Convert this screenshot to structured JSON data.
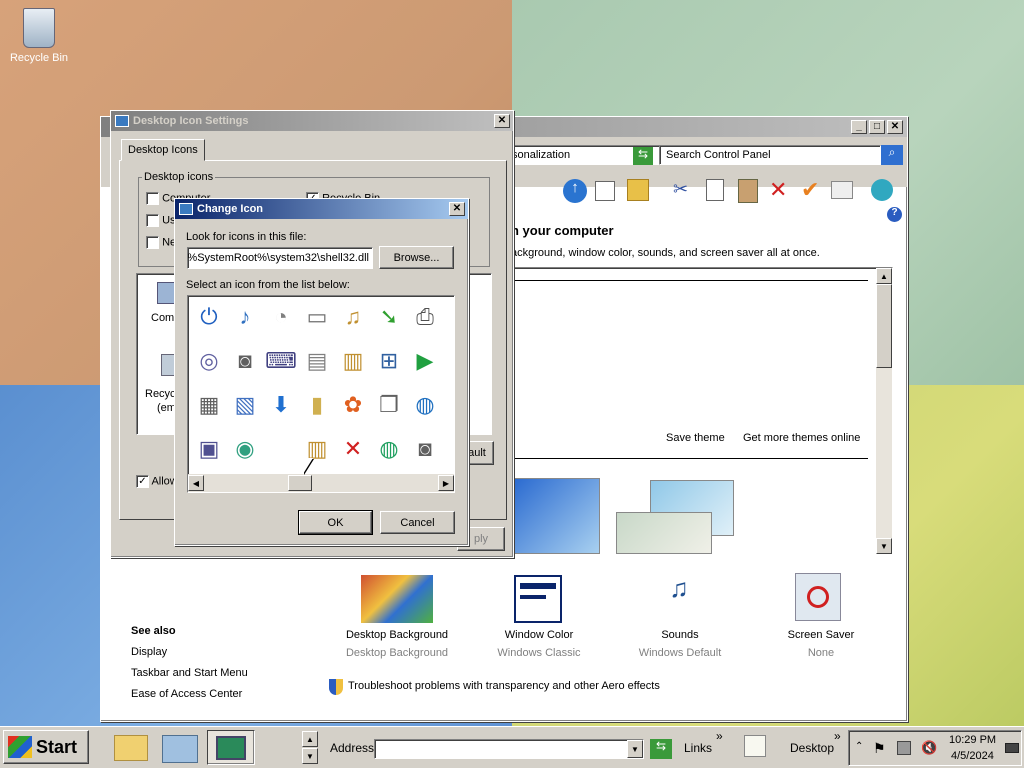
{
  "desktop": {
    "recycle_bin_label": "Recycle Bin"
  },
  "cp": {
    "address_text": "sonalization",
    "search_placeholder": "Search Control Panel",
    "heading": "n your computer",
    "subheading": "ackground, window color, sounds, and screen saver all at once.",
    "save_theme": "Save theme",
    "get_more_themes": "Get more themes online",
    "see_also_title": "See also",
    "see_also": [
      "Display",
      "Taskbar and Start Menu",
      "Ease of Access Center"
    ],
    "items": [
      {
        "label": "Desktop Background",
        "sub": "Desktop Background"
      },
      {
        "label": "Window Color",
        "sub": "Windows Classic"
      },
      {
        "label": "Sounds",
        "sub": "Windows Default"
      },
      {
        "label": "Screen Saver",
        "sub": "None"
      }
    ],
    "troubleshoot": "Troubleshoot problems with transparency and other Aero effects"
  },
  "dis": {
    "title": "Desktop Icon Settings",
    "tab": "Desktop Icons",
    "group": "Desktop icons",
    "cb_computer": "Computer",
    "cb_user": "Us",
    "cb_network": "Ne",
    "cb_recycle": "Recycle Bin",
    "list_computer": "Comp",
    "list_recycle": "Recyc",
    "list_recycle2": "(em",
    "allow": "Allow",
    "default_btn": "ault",
    "apply_btn": "ply"
  },
  "ci": {
    "title": "Change Icon",
    "look_label": "Look for icons in this file:",
    "file_path": "%SystemRoot%\\system32\\shell32.dll",
    "browse": "Browse...",
    "select_label": "Select an icon from the list below:",
    "ok": "OK",
    "cancel": "Cancel"
  },
  "taskbar": {
    "start": "Start",
    "address_label": "Address",
    "links_label": "Links",
    "desktop_label": "Desktop",
    "time": "10:29 PM",
    "date": "4/5/2024"
  },
  "icons": [
    "power-icon",
    "music-file-icon",
    "mouse-icon",
    "drive-icon",
    "music-folder-icon",
    "file-arrow-icon",
    "printer-icon",
    "dvd-icon",
    "camera-icon",
    "keyboard-icon",
    "network-drive-icon",
    "zip-folder-icon",
    "network-icon",
    "play-icon",
    "documents-icon",
    "image-file-icon",
    "download-icon",
    "folder-icon",
    "msn-butterfly-icon",
    "copy-icon",
    "globe-icon",
    "film-folder-icon",
    "cd-icon",
    "blank-icon",
    "zip-folder-icon",
    "red-x-icon",
    "globe-arrow-icon",
    "camera-icon"
  ]
}
